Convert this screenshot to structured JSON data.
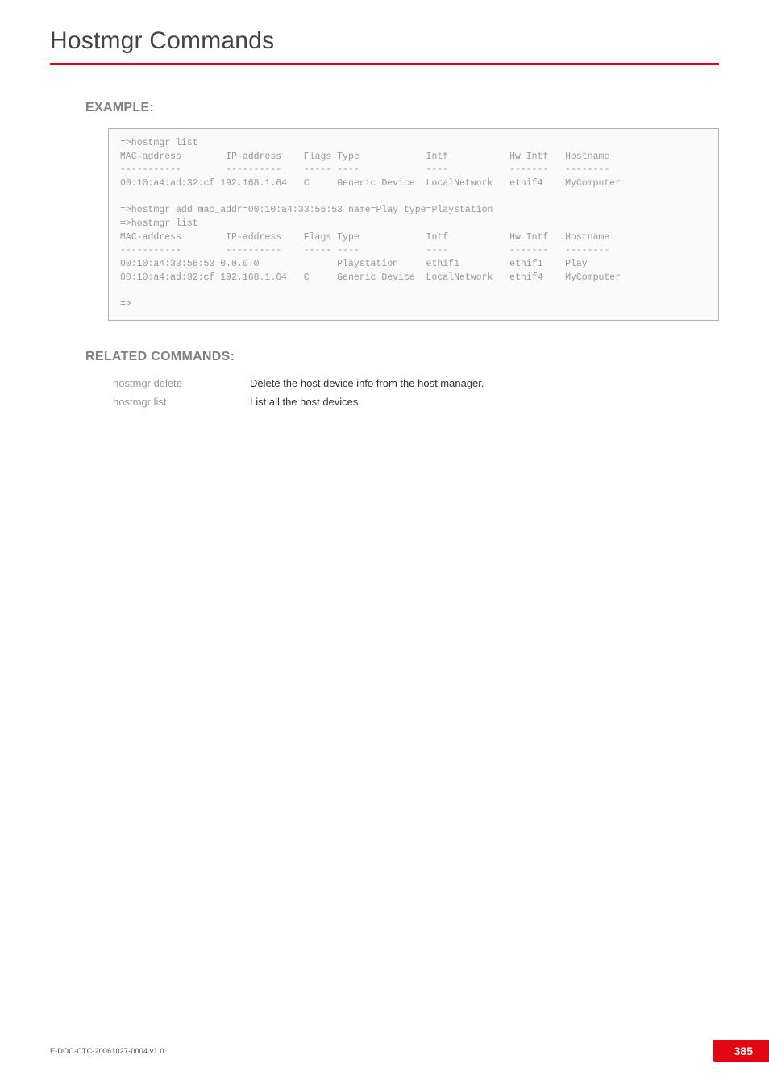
{
  "header": {
    "title": "Hostmgr Commands"
  },
  "sections": {
    "example_heading": "EXAMPLE:",
    "related_heading": "RELATED COMMANDS:"
  },
  "example_code": "=>hostmgr list\nMAC-address        IP-address    Flags Type            Intf           Hw Intf   Hostname\n-----------        ----------    ----- ----            ----           -------   --------\n00:10:a4:ad:32:cf 192.168.1.64   C     Generic Device  LocalNetwork   ethif4    MyComputer\n\n=>hostmgr add mac_addr=00:10:a4:33:56:53 name=Play type=Playstation\n=>hostmgr list\nMAC-address        IP-address    Flags Type            Intf           Hw Intf   Hostname\n-----------        ----------    ----- ----            ----           -------   --------\n00:10:a4:33:56:53 0.0.0.0              Playstation     ethif1         ethif1    Play\n00:10:a4:ad:32:cf 192.168.1.64   C     Generic Device  LocalNetwork   ethif4    MyComputer\n\n=>",
  "related_commands": [
    {
      "name": "hostmgr delete",
      "desc": "Delete the host device info from the host manager."
    },
    {
      "name": "hostmgr list",
      "desc": "List all the host devices."
    }
  ],
  "footer": {
    "doc_id": "E-DOC-CTC-20061027-0004 v1.0",
    "page_number": "385"
  }
}
